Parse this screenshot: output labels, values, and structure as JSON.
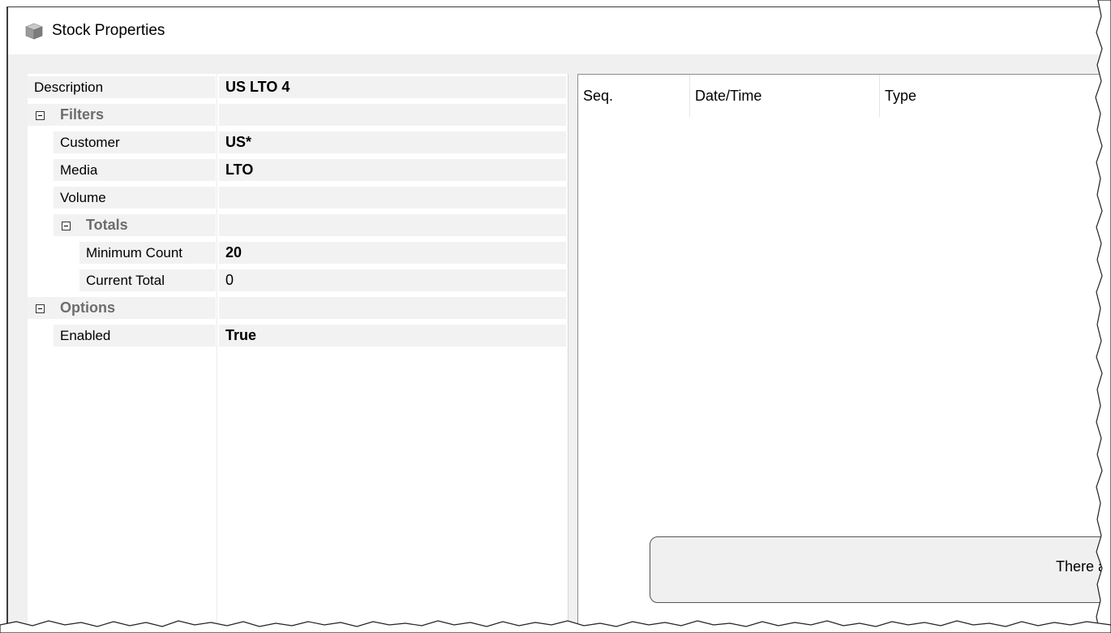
{
  "window": {
    "title": "Stock Properties",
    "icon": "stock-box-icon"
  },
  "property_grid": {
    "rows": [
      {
        "name": "Description",
        "value": "US LTO 4",
        "bold": true
      },
      {
        "name": "Filters",
        "category": true,
        "expanded": true,
        "icon": "collapse-icon"
      },
      {
        "name": "Customer",
        "value": "US*",
        "bold": true
      },
      {
        "name": "Media",
        "value": "LTO",
        "bold": true
      },
      {
        "name": "Volume",
        "value": ""
      },
      {
        "name": "Totals",
        "category": true,
        "expanded": true,
        "icon": "collapse-icon"
      },
      {
        "name": "Minimum Count",
        "value": "20",
        "bold": true
      },
      {
        "name": "Current Total",
        "value": "0",
        "bold": false
      },
      {
        "name": "Options",
        "category": true,
        "expanded": true,
        "icon": "collapse-icon"
      },
      {
        "name": "Enabled",
        "value": "True",
        "bold": true
      }
    ]
  },
  "list": {
    "columns": [
      "Seq.",
      "Date/Time",
      "Type"
    ],
    "empty_message": "There are"
  },
  "colors": {
    "window_bg": "#f0f0f0",
    "row_bg": "#f2f2f2",
    "category_text": "#6d6d6d"
  }
}
